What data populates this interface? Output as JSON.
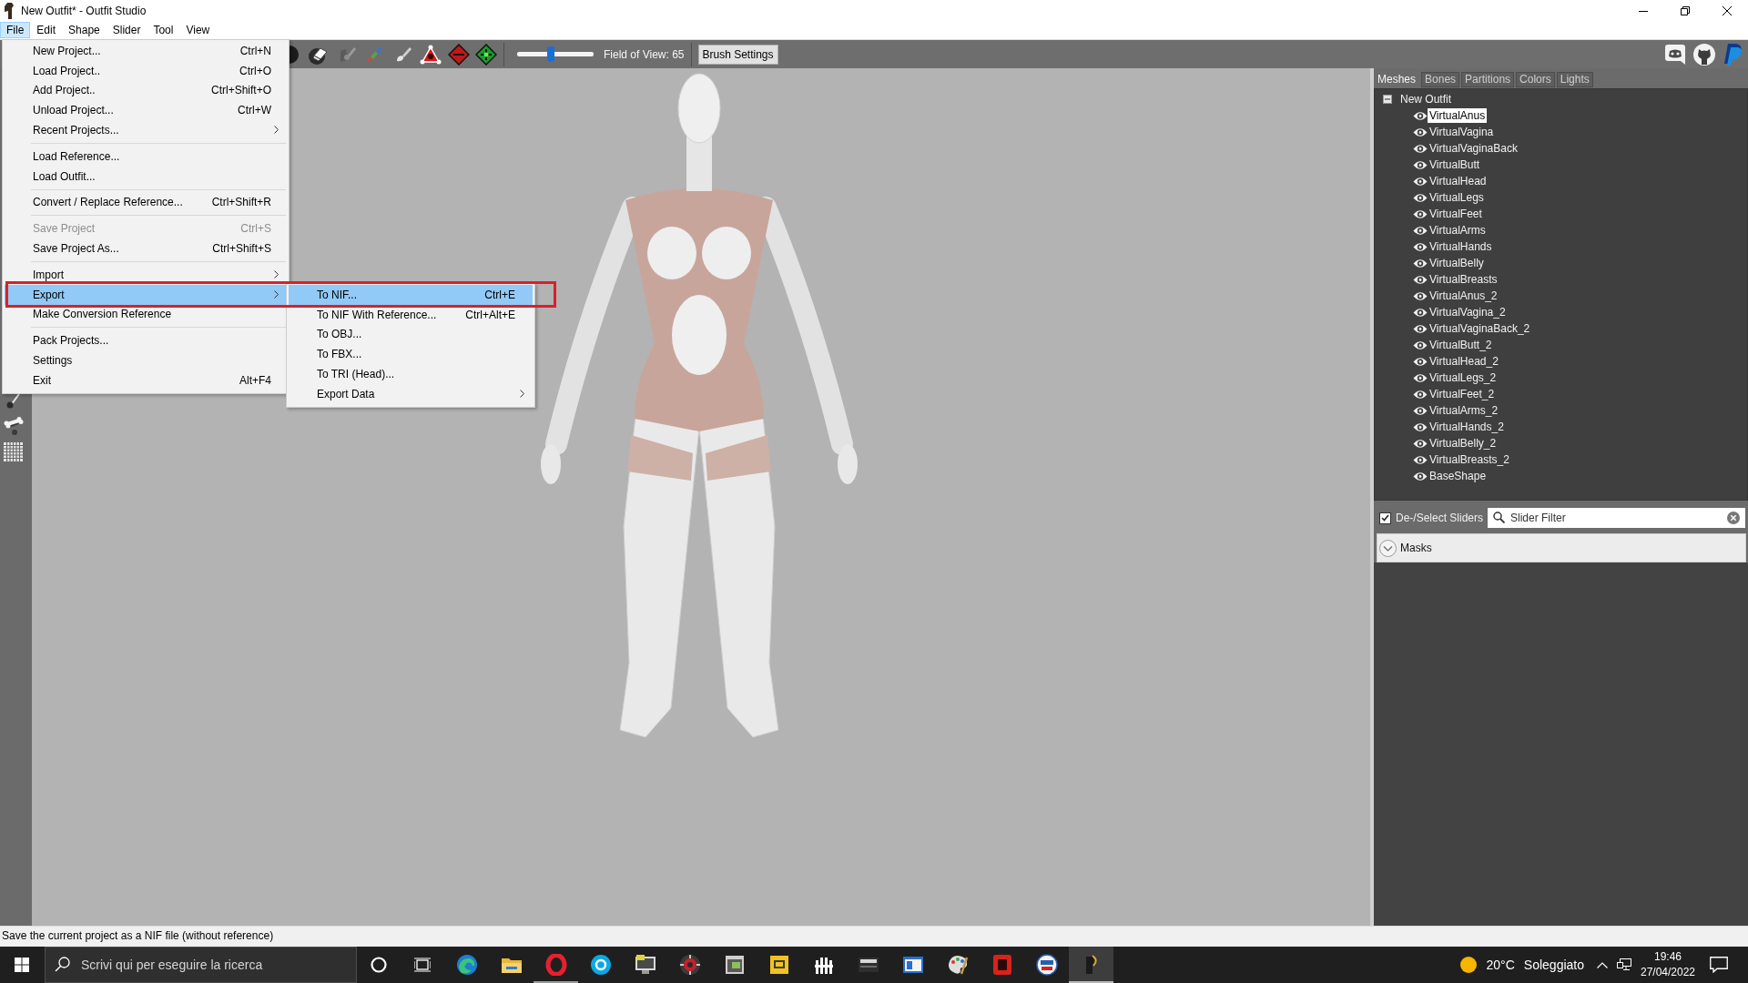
{
  "window": {
    "title": "New Outfit* - Outfit Studio"
  },
  "menu_bar": [
    {
      "label": "File",
      "selected": true
    },
    {
      "label": "Edit",
      "selected": false
    },
    {
      "label": "Shape",
      "selected": false
    },
    {
      "label": "Slider",
      "selected": false
    },
    {
      "label": "Tool",
      "selected": false
    },
    {
      "label": "View",
      "selected": false
    }
  ],
  "file_menu": [
    {
      "kind": "item",
      "label": "New Project...",
      "shortcut": "Ctrl+N",
      "disabled": false,
      "selected": false
    },
    {
      "kind": "item",
      "label": "Load Project..",
      "shortcut": "Ctrl+O",
      "disabled": false,
      "selected": false
    },
    {
      "kind": "item",
      "label": "Add Project..",
      "shortcut": "Ctrl+Shift+O",
      "disabled": false,
      "selected": false
    },
    {
      "kind": "item",
      "label": "Unload Project...",
      "shortcut": "Ctrl+W",
      "disabled": false,
      "selected": false
    },
    {
      "kind": "submenu",
      "label": "Recent Projects...",
      "disabled": false,
      "selected": false
    },
    {
      "kind": "separator"
    },
    {
      "kind": "item",
      "label": "Load Reference...",
      "disabled": false,
      "selected": false
    },
    {
      "kind": "item",
      "label": "Load Outfit...",
      "disabled": false,
      "selected": false
    },
    {
      "kind": "separator"
    },
    {
      "kind": "item",
      "label": "Convert / Replace Reference...",
      "shortcut": "Ctrl+Shift+R",
      "disabled": false,
      "selected": false
    },
    {
      "kind": "separator"
    },
    {
      "kind": "item",
      "label": "Save Project",
      "shortcut": "Ctrl+S",
      "disabled": true,
      "selected": false
    },
    {
      "kind": "item",
      "label": "Save Project As...",
      "shortcut": "Ctrl+Shift+S",
      "disabled": false,
      "selected": false
    },
    {
      "kind": "separator"
    },
    {
      "kind": "submenu",
      "label": "Import",
      "disabled": false,
      "selected": false
    },
    {
      "kind": "submenu",
      "label": "Export",
      "disabled": false,
      "selected": true
    },
    {
      "kind": "item",
      "label": "Make Conversion Reference",
      "disabled": false,
      "selected": false
    },
    {
      "kind": "separator"
    },
    {
      "kind": "item",
      "label": "Pack Projects...",
      "disabled": false,
      "selected": false
    },
    {
      "kind": "item",
      "label": "Settings",
      "disabled": false,
      "selected": false
    },
    {
      "kind": "item",
      "label": "Exit",
      "shortcut": "Alt+F4",
      "disabled": false,
      "selected": false
    }
  ],
  "export_submenu": [
    {
      "kind": "item",
      "label": "To NIF...",
      "shortcut": "Ctrl+E",
      "selected": true
    },
    {
      "kind": "item",
      "label": "To NIF With Reference...",
      "shortcut": "Ctrl+Alt+E",
      "selected": false
    },
    {
      "kind": "item",
      "label": "To OBJ...",
      "selected": false
    },
    {
      "kind": "item",
      "label": "To FBX...",
      "selected": false
    },
    {
      "kind": "item",
      "label": "To TRI (Head)...",
      "selected": false
    },
    {
      "kind": "submenu",
      "label": "Export Data",
      "selected": false
    }
  ],
  "toolbar": {
    "fov_slider": {
      "level": 0.44
    },
    "fov_label": "Field of View: 65",
    "brush_settings": "Brush Settings"
  },
  "side_panel": {
    "tabs": [
      {
        "label": "Meshes",
        "selected": true
      },
      {
        "label": "Bones",
        "selected": false
      },
      {
        "label": "Partitions",
        "selected": false
      },
      {
        "label": "Colors",
        "selected": false
      },
      {
        "label": "Lights",
        "selected": false
      }
    ],
    "mesh_tree": {
      "label": "New Outfit",
      "expanded": true,
      "children": [
        {
          "label": "VirtualAnus",
          "selected": true
        },
        {
          "label": "VirtualVagina",
          "selected": false
        },
        {
          "label": "VirtualVaginaBack",
          "selected": false
        },
        {
          "label": "VirtualButt",
          "selected": false
        },
        {
          "label": "VirtualHead",
          "selected": false
        },
        {
          "label": "VirtualLegs",
          "selected": false
        },
        {
          "label": "VirtualFeet",
          "selected": false
        },
        {
          "label": "VirtualArms",
          "selected": false
        },
        {
          "label": "VirtualHands",
          "selected": false
        },
        {
          "label": "VirtualBelly",
          "selected": false
        },
        {
          "label": "VirtualBreasts",
          "selected": false
        },
        {
          "label": "VirtualAnus_2",
          "selected": false
        },
        {
          "label": "VirtualVagina_2",
          "selected": false
        },
        {
          "label": "VirtualVaginaBack_2",
          "selected": false
        },
        {
          "label": "VirtualButt_2",
          "selected": false
        },
        {
          "label": "VirtualHead_2",
          "selected": false
        },
        {
          "label": "VirtualLegs_2",
          "selected": false
        },
        {
          "label": "VirtualFeet_2",
          "selected": false
        },
        {
          "label": "VirtualArms_2",
          "selected": false
        },
        {
          "label": "VirtualHands_2",
          "selected": false
        },
        {
          "label": "VirtualBelly_2",
          "selected": false
        },
        {
          "label": "VirtualBreasts_2",
          "selected": false
        },
        {
          "label": "BaseShape",
          "selected": false
        }
      ]
    },
    "select_sliders": {
      "label": "De-/Select Sliders",
      "checked": true
    },
    "slider_filter": {
      "placeholder": "Slider Filter"
    },
    "slider_groups": [
      {
        "label": "Masks",
        "expanded": false
      }
    ]
  },
  "status_bar": {
    "text": "Save the current project as a NIF file (without reference)"
  },
  "taskbar": {
    "search": {
      "placeholder": "Scrivi qui per eseguire la ricerca"
    },
    "apps": [
      {
        "running": false,
        "active": false
      },
      {
        "running": false,
        "active": false
      },
      {
        "running": true,
        "active": false
      },
      {
        "running": false,
        "active": false
      },
      {
        "running": false,
        "active": false
      },
      {
        "running": false,
        "active": false
      },
      {
        "running": false,
        "active": false
      },
      {
        "running": false,
        "active": false
      },
      {
        "running": false,
        "active": false
      },
      {
        "running": false,
        "active": false
      },
      {
        "running": false,
        "active": false
      },
      {
        "running": false,
        "active": false
      },
      {
        "running": false,
        "active": false
      },
      {
        "running": false,
        "active": false
      },
      {
        "running": true,
        "active": true
      }
    ],
    "weather": {
      "temperature": "20°C",
      "condition": "Soleggiato"
    },
    "clock": {
      "time": "19:46",
      "date": "27/04/2022"
    }
  }
}
